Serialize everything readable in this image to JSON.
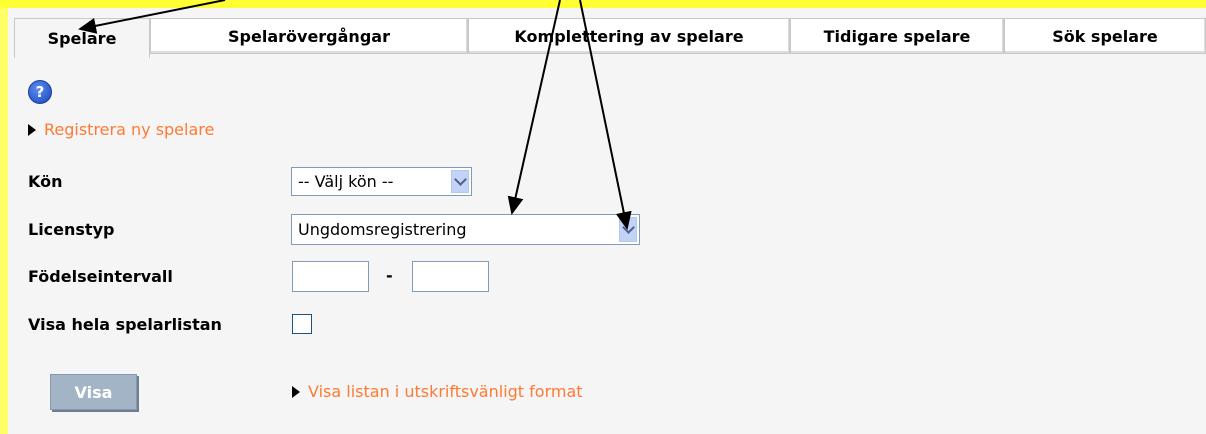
{
  "tabs": [
    {
      "label": "Spelare"
    },
    {
      "label": "Spelarövergångar"
    },
    {
      "label": "Komplettering av spelare"
    },
    {
      "label": "Tidigare spelare"
    },
    {
      "label": "Sök spelare"
    }
  ],
  "help": {
    "glyph": "?"
  },
  "register_link": "Registrera ny spelare",
  "form": {
    "gender_label": "Kön",
    "gender_value": "-- Välj kön --",
    "license_label": "Licenstyp",
    "license_value": "Ungdomsregistrering",
    "birth_label": "Födelseintervall",
    "birth_separator": "-",
    "full_list_label": "Visa hela spelarlistan",
    "full_list_checked": false
  },
  "show_button": "Visa",
  "print_link": "Visa listan i utskriftsvänligt format",
  "colors": {
    "accent_link": "#ff7a33",
    "frame_yellow": "#ffff33",
    "button": "#a3b4c7"
  }
}
